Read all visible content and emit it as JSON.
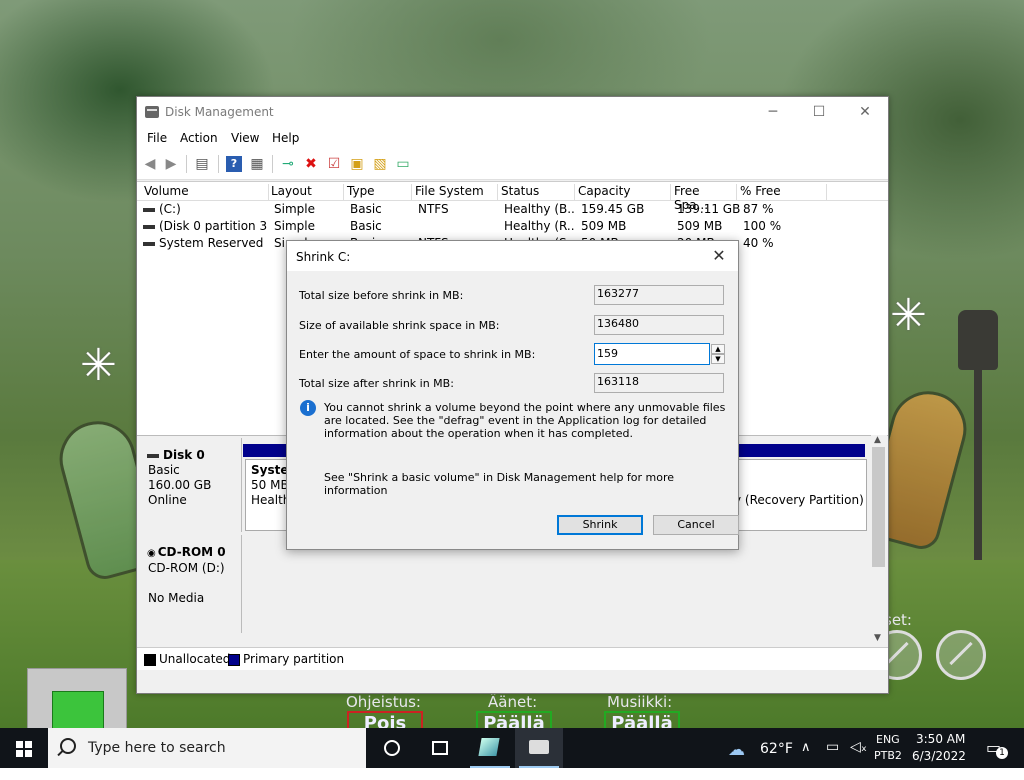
{
  "window": {
    "title": "Disk Management",
    "controls": {
      "minimize": "─",
      "maximize": "☐",
      "close": "✕"
    },
    "menu": [
      "File",
      "Action",
      "View",
      "Help"
    ]
  },
  "volume_list": {
    "headers": [
      "Volume",
      "Layout",
      "Type",
      "File System",
      "Status",
      "Capacity",
      "Free Spa...",
      "% Free"
    ],
    "rows": [
      {
        "volume": "(C:)",
        "layout": "Simple",
        "type": "Basic",
        "fs": "NTFS",
        "status": "Healthy (B...",
        "capacity": "159.45 GB",
        "free": "139.11 GB",
        "pct": "87 %"
      },
      {
        "volume": "(Disk 0 partition 3)",
        "layout": "Simple",
        "type": "Basic",
        "fs": "",
        "status": "Healthy (R...",
        "capacity": "509 MB",
        "free": "509 MB",
        "pct": "100 %"
      },
      {
        "volume": "System Reserved",
        "layout": "Simple",
        "type": "Basic",
        "fs": "NTFS",
        "status": "Healthy (S...",
        "capacity": "50 MB",
        "free": "20 MB",
        "pct": "40 %"
      }
    ]
  },
  "disks": [
    {
      "name": "Disk 0",
      "type": "Basic",
      "size": "160.00 GB",
      "state": "Online",
      "system_partition": {
        "name": "System",
        "size": "50 MB",
        "status": "Healthy"
      },
      "recovery_partition": {
        "status": "y (Recovery Partition)"
      }
    },
    {
      "name": "CD-ROM 0",
      "type": "CD-ROM (D:)",
      "state": "No Media"
    }
  ],
  "legend": {
    "unallocated": "Unallocated",
    "primary": "Primary partition",
    "unallocated_color": "#000000",
    "primary_color": "#00008b"
  },
  "dialog": {
    "title": "Shrink C:",
    "close": "✕",
    "total_before_label": "Total size before shrink in MB:",
    "total_before_value": "163277",
    "available_label": "Size of available shrink space in MB:",
    "available_value": "136480",
    "amount_label": "Enter the amount of space to shrink in MB:",
    "amount_value": "159",
    "total_after_label": "Total size after shrink in MB:",
    "total_after_value": "163118",
    "info_text": "You cannot shrink a volume beyond the point where any unmovable files are located. See the \"defrag\" event in the Application log for detailed information about the operation when it has completed.",
    "help_text": "See \"Shrink a basic volume\" in Disk Management help for more information",
    "shrink_button": "Shrink",
    "cancel_button": "Cancel"
  },
  "background_game": {
    "labels": [
      "Ohjeistus:",
      "Äänet:",
      "Musiikki:"
    ],
    "buttons": [
      "Pois",
      "Päällä",
      "Päällä"
    ],
    "settings_label": "set:"
  },
  "taskbar": {
    "search_placeholder": "Type here to search",
    "weather": "62°F",
    "language": "ENG",
    "keyboard": "PTB2",
    "time": "3:50 AM",
    "date": "6/3/2022",
    "notification_count": "1"
  },
  "colors": {
    "accent": "#0078d7",
    "primary_partition": "#00008b",
    "taskbar": "#101419"
  }
}
